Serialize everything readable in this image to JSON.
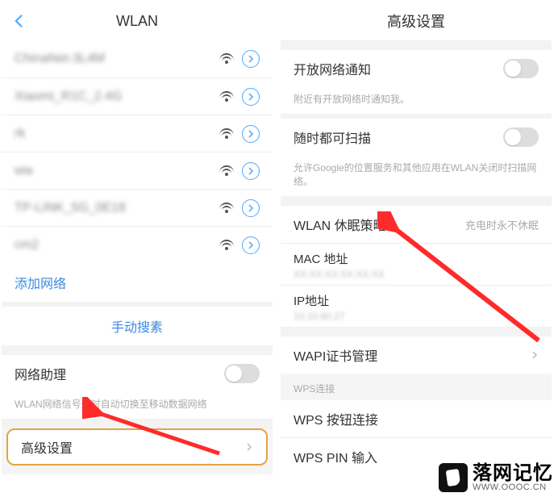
{
  "left": {
    "title": "WLAN",
    "networks": [
      {
        "name": "ChinaNet-3L4M"
      },
      {
        "name": "Xiaomi_R1C_2.4G"
      },
      {
        "name": "rk"
      },
      {
        "name": "ww"
      },
      {
        "name": "TP-LINK_5G_0E18"
      },
      {
        "name": "cm2"
      }
    ],
    "add_network": "添加网络",
    "manual_search": "手动搜素",
    "net_assist": {
      "title": "网络助理",
      "desc": "WLAN网络信号差时自动切换至移动数据网络"
    },
    "advanced": "高级设置"
  },
  "right": {
    "title": "高级设置",
    "open_net": {
      "title": "开放网络通知",
      "desc": "附近有开放网络时通知我。"
    },
    "scan_always": {
      "title": "随时都可扫描",
      "desc": "允许Google的位置服务和其他应用在WLAN关闭时扫描网络。"
    },
    "sleep_policy": {
      "title": "WLAN 休眠策略",
      "value": "充电时永不休眠"
    },
    "mac": {
      "title": "MAC 地址"
    },
    "ip": {
      "title": "IP地址"
    },
    "wapi": "WAPI证书管理",
    "wps_section": "WPS连接",
    "wps_button": "WPS 按钮连接",
    "wps_pin": "WPS PIN 输入"
  },
  "watermark": {
    "cn": "落网记忆",
    "url": "WWW.OOOC.CN"
  }
}
